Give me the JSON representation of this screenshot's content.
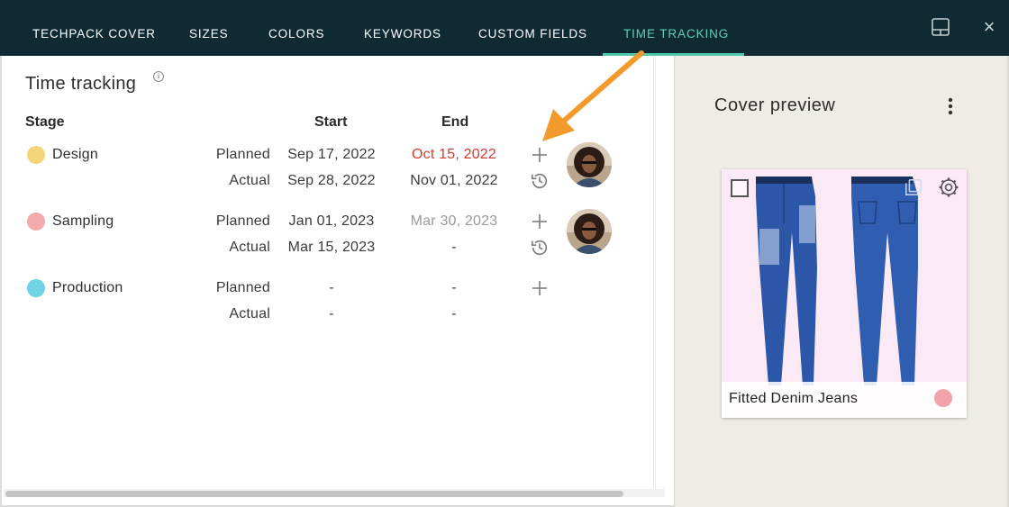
{
  "tabs": [
    {
      "label": "TECHPACK COVER",
      "active": false
    },
    {
      "label": "SIZES",
      "active": false
    },
    {
      "label": "COLORS",
      "active": false
    },
    {
      "label": "KEYWORDS",
      "active": false
    },
    {
      "label": "CUSTOM FIELDS",
      "active": false
    },
    {
      "label": "TIME TRACKING",
      "active": true
    }
  ],
  "window_controls": {
    "layout_icon": "panel-layout-icon",
    "close_icon": "close-icon",
    "close_label": "×"
  },
  "time_tracking": {
    "title": "Time tracking",
    "info_icon": "i",
    "headers": {
      "stage": "Stage",
      "start": "Start",
      "end": "End"
    },
    "stages": [
      {
        "name": "Design",
        "color": "#f4d67a",
        "planned": {
          "label": "Planned",
          "start": "Sep 17, 2022",
          "end": "Oct 15, 2022",
          "end_style": "overdue"
        },
        "actual": {
          "label": "Actual",
          "start": "Sep 28, 2022",
          "end": "Nov 01, 2022"
        },
        "has_history": true,
        "has_avatar": true
      },
      {
        "name": "Sampling",
        "color": "#f2aaaa",
        "planned": {
          "label": "Planned",
          "start": "Jan 01, 2023",
          "end": "Mar 30, 2023",
          "end_style": "muted"
        },
        "actual": {
          "label": "Actual",
          "start": "Mar 15, 2023",
          "end": "-"
        },
        "has_history": true,
        "has_avatar": true
      },
      {
        "name": "Production",
        "color": "#6fd3e3",
        "planned": {
          "label": "Planned",
          "start": "-",
          "end": "-",
          "end_style": "normal"
        },
        "actual": {
          "label": "Actual",
          "start": "-",
          "end": "-"
        },
        "has_history": false,
        "has_avatar": false
      }
    ]
  },
  "cover_preview": {
    "title": "Cover preview",
    "product_name": "Fitted Denim Jeans",
    "status_color": "#f0a3a8",
    "accent": "#4fc9aa"
  }
}
